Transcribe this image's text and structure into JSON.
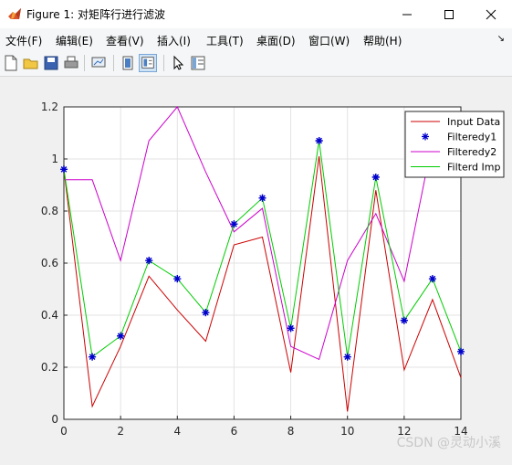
{
  "window": {
    "title": "Figure 1: 对矩阵行进行滤波"
  },
  "menu": [
    "文件(F)",
    "编辑(E)",
    "查看(V)",
    "插入(I)",
    "工具(T)",
    "桌面(D)",
    "窗口(W)",
    "帮助(H)"
  ],
  "toolbar": {
    "buttons": [
      "new-figure",
      "open-file",
      "save",
      "print",
      "link-plot",
      "hide-plot-tools",
      "show-plot-tools",
      "edit-plot",
      "insert-colorbar"
    ]
  },
  "watermark": "CSDN @灵动小溪",
  "chart_data": {
    "type": "line",
    "x": [
      0,
      1,
      2,
      3,
      4,
      5,
      6,
      7,
      8,
      9,
      10,
      11,
      12,
      13,
      14
    ],
    "xlim": [
      0,
      14
    ],
    "ylim": [
      0,
      1.2
    ],
    "xticks": [
      "0",
      "2",
      "4",
      "6",
      "8",
      "10",
      "12",
      "14"
    ],
    "yticks": [
      "0",
      "0.2",
      "0.4",
      "0.6",
      "0.8",
      "1",
      "1.2"
    ],
    "grid": true,
    "legend_position": "top-right",
    "series": [
      {
        "name": "Input Data",
        "color": "#cc0000",
        "marker": "none",
        "values": [
          0.96,
          0.05,
          0.28,
          0.55,
          0.42,
          0.3,
          0.67,
          0.7,
          0.18,
          1.01,
          0.03,
          0.88,
          0.19,
          0.46,
          0.16
        ]
      },
      {
        "name": "Filteredy1",
        "color": "#0000cc",
        "marker": "asterisk",
        "values": [
          0.96,
          0.24,
          0.32,
          0.61,
          0.54,
          0.41,
          0.75,
          0.85,
          0.35,
          1.07,
          0.24,
          0.93,
          0.38,
          0.54,
          0.26
        ]
      },
      {
        "name": "Filteredy2",
        "color": "#cc00cc",
        "marker": "none",
        "values": [
          0.92,
          0.92,
          0.61,
          1.07,
          1.2,
          0.95,
          0.72,
          0.81,
          0.28,
          0.23,
          0.61,
          0.79,
          0.53,
          1.07,
          null
        ]
      },
      {
        "name": "Filterd Imp",
        "color": "#00cc00",
        "marker": "none",
        "values": [
          0.96,
          0.24,
          0.32,
          0.61,
          0.54,
          0.41,
          0.75,
          0.85,
          0.35,
          1.07,
          0.24,
          0.93,
          0.38,
          0.54,
          0.26
        ]
      }
    ]
  }
}
